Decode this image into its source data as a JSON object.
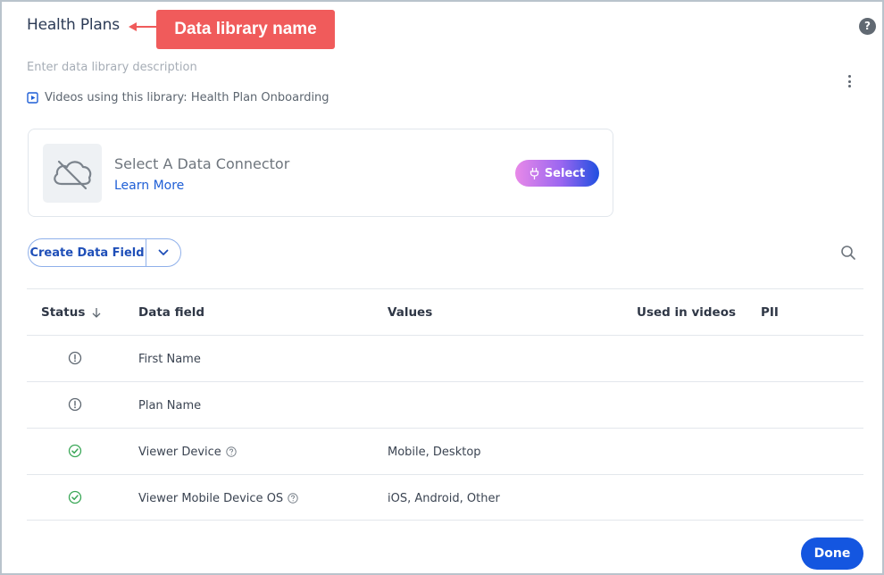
{
  "header": {
    "title": "Health Plans",
    "callout_label": "Data library name",
    "help_icon": "?"
  },
  "library": {
    "description_placeholder": "Enter data library description",
    "videos_using": "Videos using this library: Health Plan Onboarding"
  },
  "connector": {
    "title": "Select A Data Connector",
    "learn_more": "Learn More",
    "select_label": "Select"
  },
  "toolbar": {
    "create_label": "Create Data Field"
  },
  "table": {
    "headers": {
      "status": "Status",
      "field": "Data field",
      "values": "Values",
      "used": "Used in videos",
      "pii": "PII"
    },
    "rows": [
      {
        "status": "warning",
        "field": "First Name",
        "has_help": false,
        "values": "",
        "used": "",
        "pii": ""
      },
      {
        "status": "warning",
        "field": "Plan Name",
        "has_help": false,
        "values": "",
        "used": "",
        "pii": ""
      },
      {
        "status": "ok",
        "field": "Viewer Device",
        "has_help": true,
        "values": "Mobile, Desktop",
        "used": "",
        "pii": ""
      },
      {
        "status": "ok",
        "field": "Viewer Mobile Device OS",
        "has_help": true,
        "values": "iOS, Android, Other",
        "used": "",
        "pii": ""
      }
    ]
  },
  "footer": {
    "done_label": "Done"
  },
  "colors": {
    "accent": "#1456e0",
    "callout": "#f05b5b",
    "ok": "#3aa757",
    "warning": "#5d6670"
  }
}
